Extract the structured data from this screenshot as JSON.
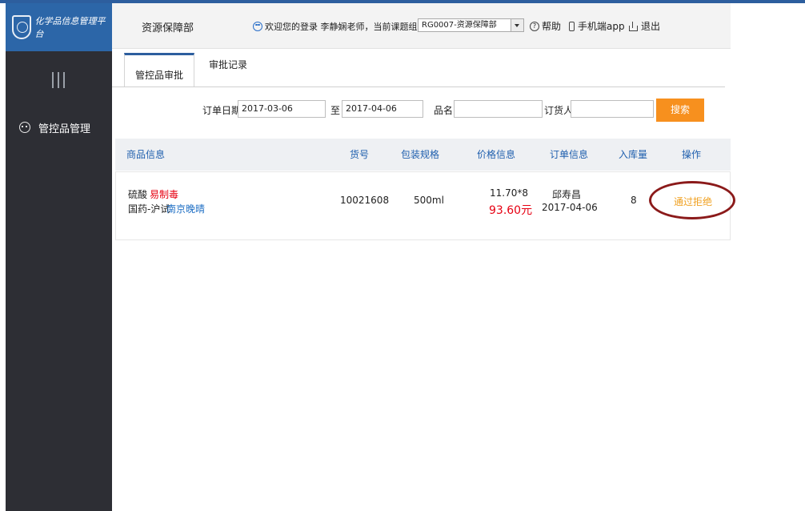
{
  "sidebar": {
    "brand_title": "化学品信息管理平台",
    "items": [
      {
        "label": "管控品管理"
      }
    ]
  },
  "header": {
    "department": "资源保障部",
    "welcome": "欢迎您的登录 李静娴老师，当前课题组：",
    "group": "RG0007-资源保障部",
    "help": "帮助",
    "app": "手机端app",
    "exit": "退出"
  },
  "tabs": [
    {
      "label": "管控品审批"
    },
    {
      "label": "审批记录"
    }
  ],
  "filters": {
    "date_label": "订单日期",
    "date_from": "2017-03-06",
    "to_label": "至",
    "date_to": "2017-04-06",
    "name_label": "品名",
    "name_value": "",
    "buyer_label": "订货人",
    "buyer_value": "",
    "search_button": "搜索"
  },
  "table": {
    "headers": [
      "商品信息",
      "货号",
      "包装规格",
      "价格信息",
      "订单信息",
      "入库量",
      "操作"
    ],
    "rows": [
      {
        "name": "硫酸",
        "tag": "易制毒",
        "supplier": "国药-沪试",
        "vendor": "南京晚晴",
        "code": "10021608",
        "spec": "500ml",
        "unit_price": "11.70*8",
        "total": "93.60元",
        "buyer": "邱寿昌",
        "order_date": "2017-04-06",
        "qty": "8",
        "approve": "通过",
        "reject": "拒绝"
      }
    ]
  },
  "colors": {
    "brand": "#2c66a8",
    "sidebar": "#2d2e34",
    "accent": "#f7901e",
    "link": "#1f5fae",
    "alert": "#e60012"
  }
}
